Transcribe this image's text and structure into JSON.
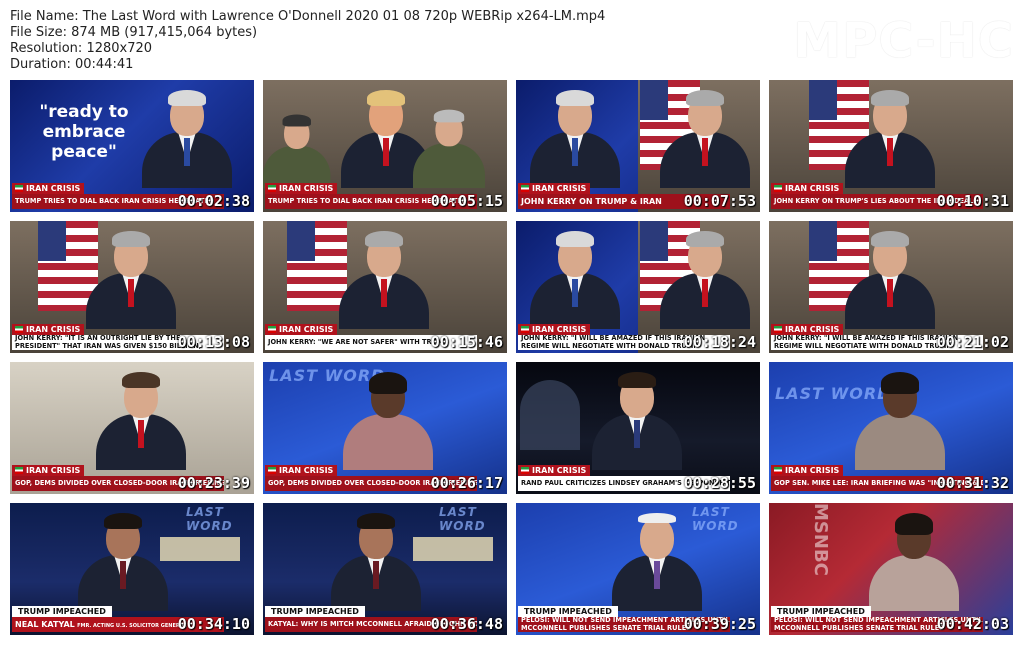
{
  "file_info": {
    "name": "File Name: The Last Word with Lawrence O'Donnell 2020 01 08 720p WEBRip x264-LM.mp4",
    "size": "File Size: 874 MB (917,415,064 bytes)",
    "resolution": "Resolution: 1280x720",
    "duration": "Duration: 00:44:41"
  },
  "logo": "MPC-HC",
  "thumbnails": [
    {
      "tag": "IRAN CRISIS",
      "caption": "TRUMP TRIES TO DIAL BACK IRAN CRISIS HE CREATED",
      "time": "00:02:38",
      "quote": "\"ready to embrace peace\""
    },
    {
      "tag": "IRAN CRISIS",
      "caption": "TRUMP TRIES TO DIAL BACK IRAN CRISIS HE CREATED",
      "time": "00:05:15"
    },
    {
      "tag": "IRAN CRISIS",
      "caption": "JOHN KERRY ON TRUMP & IRAN",
      "time": "00:07:53"
    },
    {
      "tag": "IRAN CRISIS",
      "caption": "JOHN KERRY ON TRUMP'S LIES ABOUT THE IRAN DEAL",
      "time": "00:10:31"
    },
    {
      "tag": "IRAN CRISIS",
      "caption": "JOHN KERRY: \"IT IS AN OUTRIGHT LIE BY THE PRESIDENT\" THAT IRAN WAS GIVEN $150 BILLION, \"THEY WERE NOT",
      "time": "00:13:08"
    },
    {
      "tag": "IRAN CRISIS",
      "caption": "JOHN KERRY: \"WE ARE NOT SAFER\" WITH TRUMP",
      "time": "00:15:46"
    },
    {
      "tag": "IRAN CRISIS",
      "caption": "JOHN KERRY: \"I WILL BE AMAZED IF THIS IRANIAN REGIME WILL NEGOTIATE WITH DONALD TRUMP\"",
      "time": "00:18:24"
    },
    {
      "tag": "IRAN CRISIS",
      "caption": "JOHN KERRY: \"I WILL BE AMAZED IF THIS IRANIAN REGIME WILL NEGOTIATE WITH DONALD TRUMP\"",
      "time": "00:21:02"
    },
    {
      "tag": "IRAN CRISIS",
      "caption": "GOP, DEMS DIVIDED OVER CLOSED-DOOR IRAN BRIEFING",
      "time": "00:23:39"
    },
    {
      "tag": "IRAN CRISIS",
      "caption": "GOP, DEMS DIVIDED OVER CLOSED-DOOR IRAN BRIEFING",
      "time": "00:26:17"
    },
    {
      "tag": "IRAN CRISIS",
      "caption": "RAND PAUL CRITICIZES LINDSEY GRAHAM'S RESPONSE TO IRAN BRIEFING",
      "time": "00:28:55"
    },
    {
      "tag": "IRAN CRISIS",
      "caption": "GOP SEN. MIKE LEE: IRAN BRIEFING WAS \"INSULTING & DEMEANING\"",
      "time": "00:31:32"
    },
    {
      "tag": "TRUMP IMPEACHED",
      "caption": "NEAL KATYAL",
      "sub": "FMR. ACTING U.S. SOLICITOR GENERAL",
      "time": "00:34:10"
    },
    {
      "tag": "TRUMP IMPEACHED",
      "caption": "KATYAL: WHY IS MITCH MCCONNELL AFRAID OF JOHN BOLTON?",
      "time": "00:36:48"
    },
    {
      "tag": "TRUMP IMPEACHED",
      "caption": "PELOSI: WILL NOT SEND IMPEACHMENT ARTICLES UNTIL MCCONNELL PUBLISHES SENATE TRIAL RULES",
      "time": "00:39:25"
    },
    {
      "tag": "TRUMP IMPEACHED",
      "caption": "PELOSI: WILL NOT SEND IMPEACHMENT ARTICLES UNTIL MCCONNELL PUBLISHES SENATE TRIAL RULES",
      "time": "00:42:03"
    }
  ],
  "network": "MSNBC",
  "show_name": "LAST WORD"
}
